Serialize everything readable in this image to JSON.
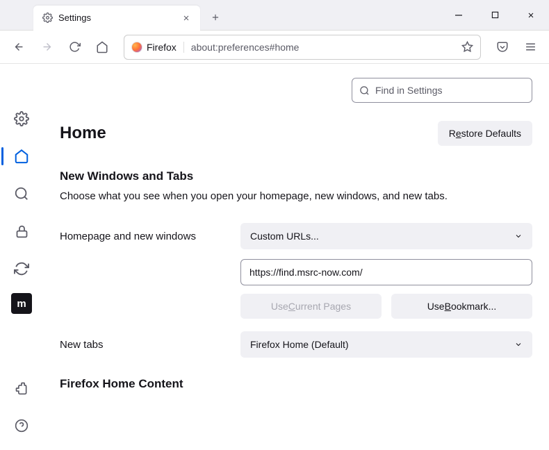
{
  "window": {
    "tab_title": "Settings"
  },
  "toolbar": {
    "identity_label": "Firefox",
    "url": "about:preferences#home"
  },
  "search": {
    "placeholder": "Find in Settings"
  },
  "page": {
    "title": "Home",
    "restore_label_pre": "R",
    "restore_label_ul": "e",
    "restore_label_post": "store Defaults",
    "section1_title": "New Windows and Tabs",
    "section1_desc": "Choose what you see when you open your homepage, new windows, and new tabs.",
    "homepage_label": "Homepage and new windows",
    "homepage_select": "Custom URLs...",
    "homepage_value": "https://find.msrc-now.com/",
    "use_current_pre": "Use ",
    "use_current_ul": "C",
    "use_current_post": "urrent Pages",
    "use_bookmark_pre": "Use ",
    "use_bookmark_ul": "B",
    "use_bookmark_post": "ookmark...",
    "newtabs_label": "New tabs",
    "newtabs_select": "Firefox Home (Default)",
    "section2_title": "Firefox Home Content"
  },
  "sidebar": {
    "mozilla_label": "m"
  }
}
